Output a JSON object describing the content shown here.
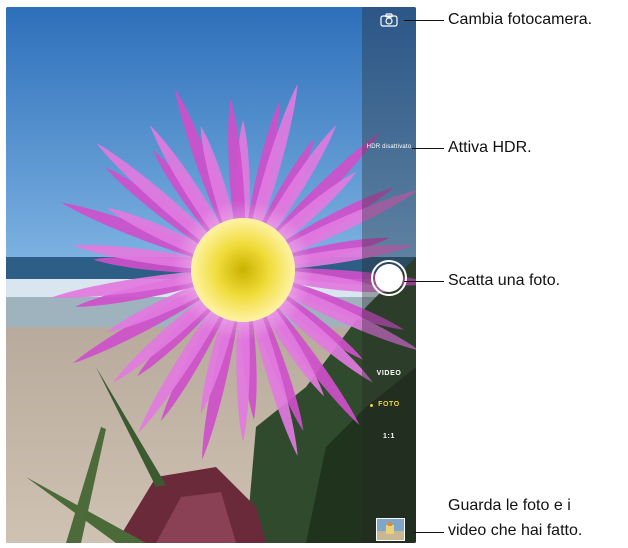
{
  "camera": {
    "hdr_label": "HDR disattivato",
    "modes": {
      "video": "VIDEO",
      "photo": "FOTO",
      "square": "1:1"
    },
    "selected_mode": "FOTO",
    "colors": {
      "mode_selected": "#f6d23a",
      "panel": "#282828"
    }
  },
  "callouts": {
    "switch_camera": "Cambia fotocamera.",
    "hdr": "Attiva HDR.",
    "shutter": "Scatta una foto.",
    "gallery_line1": "Guarda le foto e i",
    "gallery_line2": "video che hai fatto."
  },
  "icons": {
    "switch_camera": "camera-rotate-icon",
    "shutter": "shutter-button-icon",
    "thumbnail": "photo-thumbnail-icon"
  }
}
